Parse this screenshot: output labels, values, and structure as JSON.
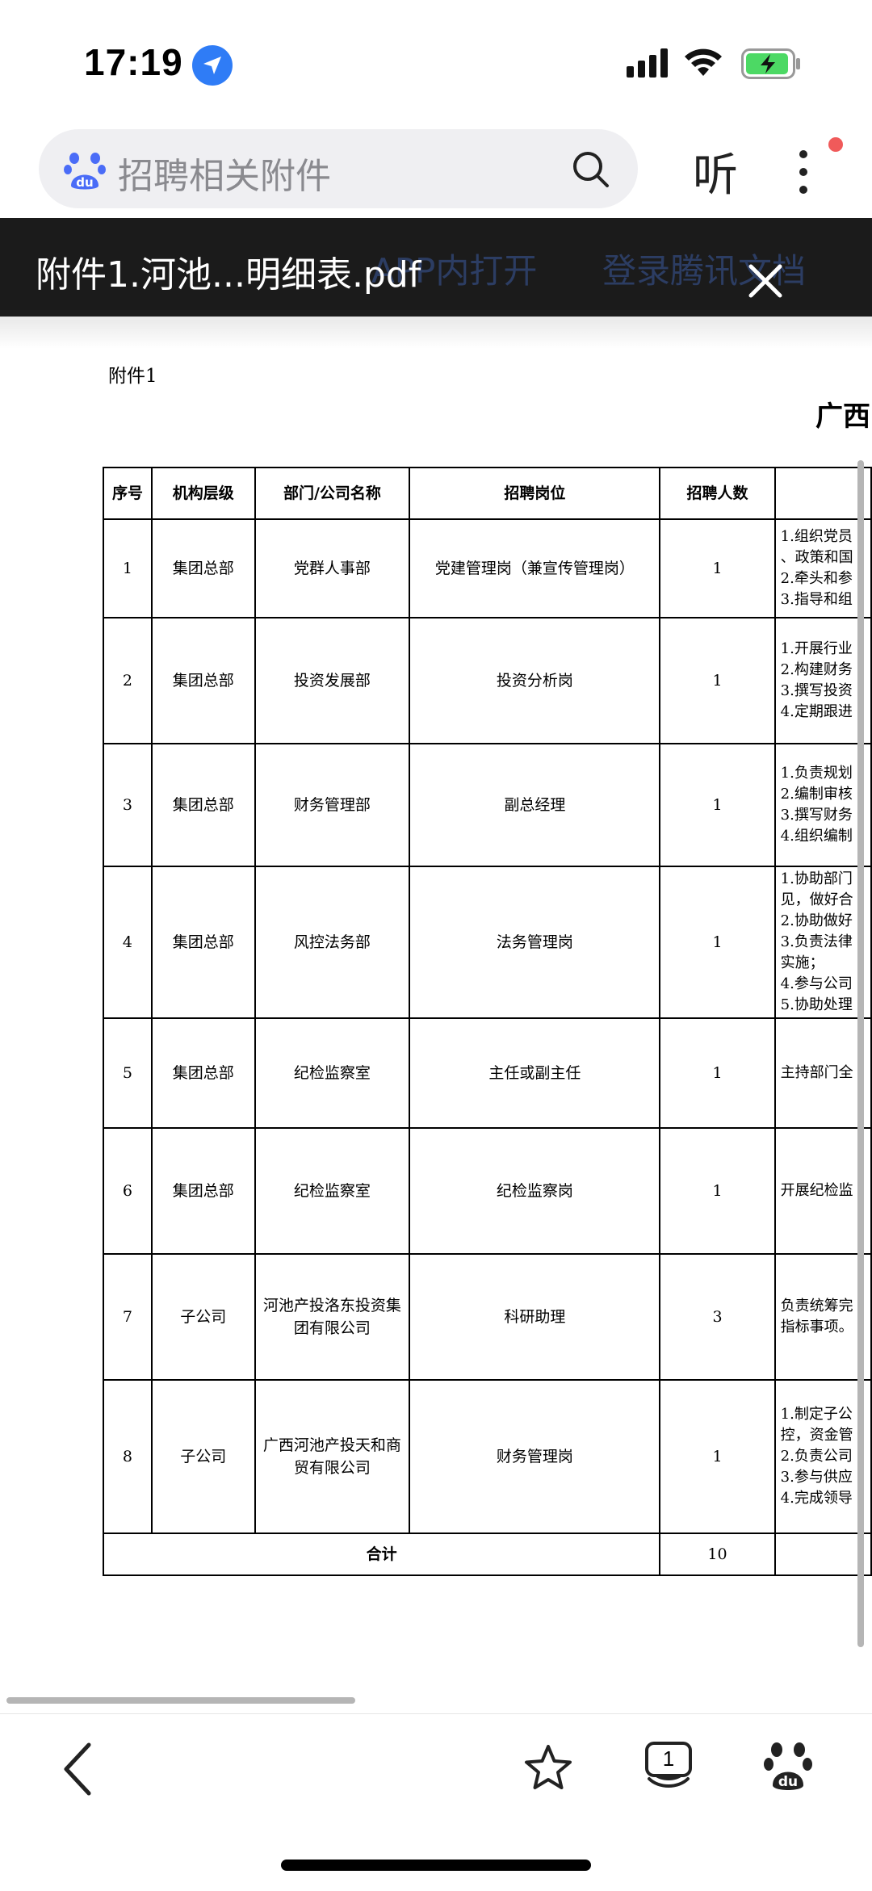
{
  "status": {
    "time": "17:19"
  },
  "search": {
    "text": "招聘相关附件",
    "listen": "听"
  },
  "doc_bar": {
    "title": "附件1.河池...明细表.pdf",
    "ghost_open_app": "APP内打开",
    "ghost_login": "登录腾讯文档"
  },
  "pdf": {
    "attachment_label": "附件1",
    "title_partial": "广西",
    "headers": [
      "序号",
      "机构层级",
      "部门/公司名称",
      "招聘岗位",
      "招聘人数"
    ],
    "rows": [
      {
        "no": "1",
        "level": "集团总部",
        "dept": "党群人事部",
        "post": "党建管理岗（兼宣传管理岗）",
        "count": "1",
        "duty": [
          "1.组织党员",
          "、政策和国",
          "2.牵头和参",
          "3.指导和组"
        ]
      },
      {
        "no": "2",
        "level": "集团总部",
        "dept": "投资发展部",
        "post": "投资分析岗",
        "count": "1",
        "duty": [
          "1.开展行业",
          "2.构建财务",
          "3.撰写投资",
          "4.定期跟进"
        ]
      },
      {
        "no": "3",
        "level": "集团总部",
        "dept": "财务管理部",
        "post": "副总经理",
        "count": "1",
        "duty": [
          "1.负责规划",
          "2.编制审核",
          "3.撰写财务",
          "4.组织编制"
        ]
      },
      {
        "no": "4",
        "level": "集团总部",
        "dept": "风控法务部",
        "post": "法务管理岗",
        "count": "1",
        "duty": [
          "1.协助部门",
          "见，做好合",
          "2.协助做好",
          "3.负责法律",
          "实施；",
          "4.参与公司",
          "5.协助处理"
        ]
      },
      {
        "no": "5",
        "level": "集团总部",
        "dept": "纪检监察室",
        "post": "主任或副主任",
        "count": "1",
        "duty": [
          "主持部门全"
        ]
      },
      {
        "no": "6",
        "level": "集团总部",
        "dept": "纪检监察室",
        "post": "纪检监察岗",
        "count": "1",
        "duty": [
          "开展纪检监"
        ]
      },
      {
        "no": "7",
        "level": "子公司",
        "dept": "河池产投洛东投资集团有限公司",
        "post": "科研助理",
        "count": "3",
        "duty": [
          "负责统筹完",
          "指标事项。"
        ]
      },
      {
        "no": "8",
        "level": "子公司",
        "dept": "广西河池产投天和商贸有限公司",
        "post": "财务管理岗",
        "count": "1",
        "duty": [
          "1.制定子公",
          "控，资金管",
          "2.负责公司",
          "3.参与供应",
          "4.完成领导"
        ]
      }
    ],
    "total_label": "合计",
    "total_count": "10"
  },
  "toolbar": {
    "tab_count": "1"
  },
  "colors": {
    "accent": "#2f7cf6",
    "doc_bar": "#1b1b1b",
    "search_bg": "#efeff2",
    "battery_green": "#4cd964"
  }
}
